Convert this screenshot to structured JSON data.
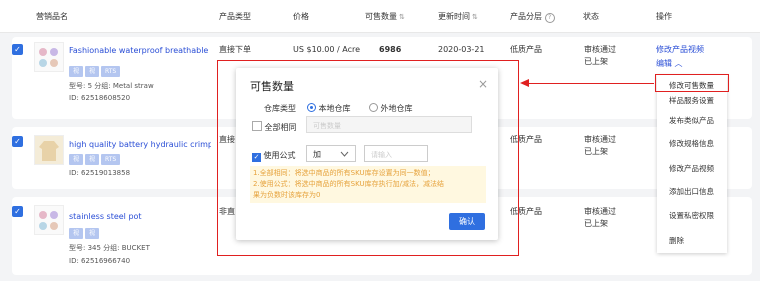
{
  "header": {
    "columns": [
      "营销品名",
      "产品类型",
      "价格",
      "可售数量",
      "更新时间",
      "产品分层",
      "状态",
      "操作"
    ],
    "sort_glyph": "⇅",
    "help_glyph": "?"
  },
  "rows": [
    {
      "name": "Fashionable waterproof breathable mou",
      "tags": [
        "视",
        "视",
        "RTS"
      ],
      "model_line": "型号: 5  分组: Metal straw",
      "id_line": "ID: 62518608520",
      "type": "直接下单",
      "price": "US $10.00 / Acre",
      "qty": "6986",
      "updated": "2020-03-21",
      "layer": "低质产品",
      "status1": "审核通过",
      "status2": "已上架",
      "ops_link": "修改产品视频",
      "ops_edit": "编辑 ︿"
    },
    {
      "name": "high quality battery hydraulic crimping t",
      "tags": [
        "视",
        "视",
        "RTS"
      ],
      "id_line": "ID: 62519013858",
      "type": "直接",
      "layer": "低质产品",
      "status1": "审核通过",
      "status2": "已上架"
    },
    {
      "name": "stainless steel pot",
      "tags": [
        "视",
        "视"
      ],
      "model_line": "型号: 345  分组: BUCKET",
      "id_line": "ID: 62516966740",
      "type": "非直",
      "layer": "低质产品",
      "status1": "审核通过",
      "status2": "已上架"
    }
  ],
  "modal": {
    "title": "可售数量",
    "close": "×",
    "warehouse_label": "仓库类型",
    "radio_local": "本地仓库",
    "radio_overseas": "外地仓库",
    "all_same_label": "全部相同",
    "qty_placeholder": "可售数量",
    "use_formula_label": "使用公式",
    "formula_op": "加",
    "input_placeholder": "请输入",
    "note1": "1.全部相同：将选中商品的所有SKU库存设置为同一数值；",
    "note2": "2.使用公式：将选中商品的所有SKU库存执行加/减法，减法结",
    "note3": "果为负数时该库存为0",
    "confirm": "确认"
  },
  "dropdown": {
    "items": [
      "修改可售数量",
      "样品服务设置",
      "发布类似产品",
      "修改规格信息",
      "修改产品视频",
      "添加出口信息",
      "设置私密权限",
      "删除"
    ]
  },
  "colors": {
    "accent": "#2f6fe0",
    "link": "#2a4ed6",
    "warning": "#e6a23c",
    "highlight": "#e02020"
  }
}
